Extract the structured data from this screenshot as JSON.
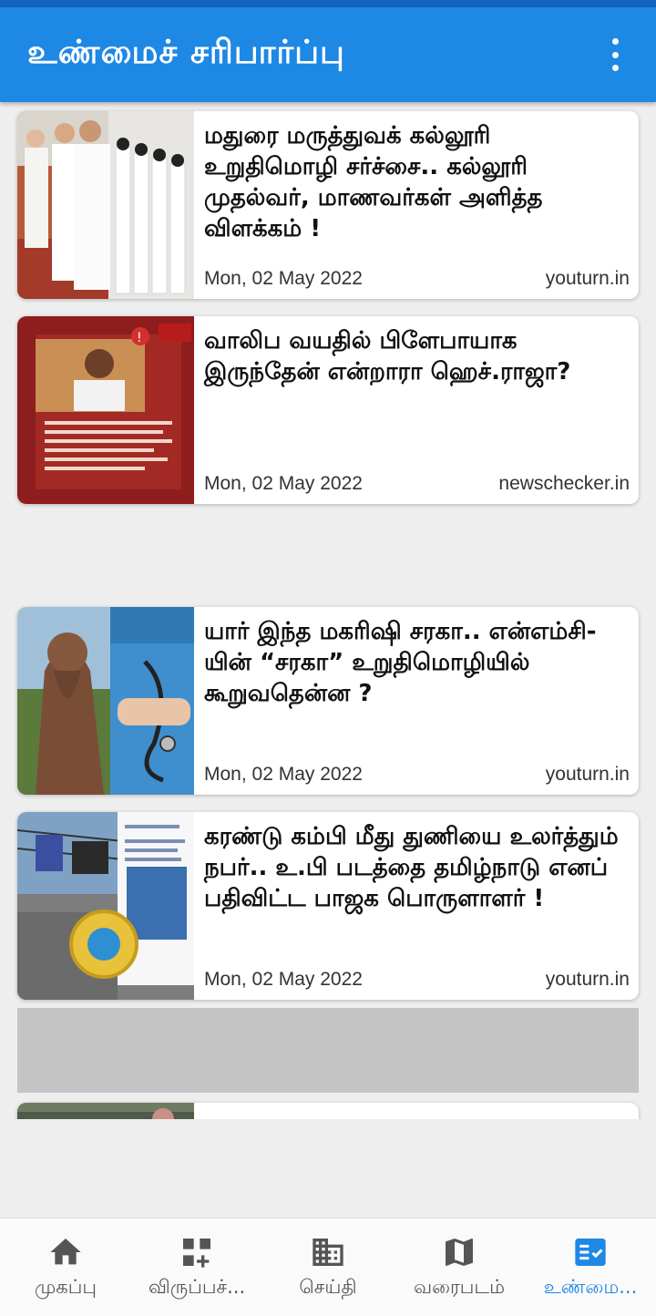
{
  "app": {
    "title": "உண்மைச் சரிபார்ப்பு",
    "colors": {
      "primary": "#1e88e5",
      "background": "#eeeeee",
      "active": "#1e88e5"
    }
  },
  "articles": [
    {
      "headline": "மதுரை மருத்துவக் கல்லூரி உறுதிமொழி சர்ச்சை.. கல்லூரி முதல்வர், மாணவர்கள் அளித்த விளக்கம் !",
      "date": "Mon, 02 May 2022",
      "source": "youturn.in"
    },
    {
      "headline": "வாலிப வயதில் பிளேபாயாக இருந்தேன் என்றாரா ஹெச்.ராஜா?",
      "date": "Mon, 02 May 2022",
      "source": "newschecker.in"
    },
    {
      "headline": "யார் இந்த மகரிஷி சரகா.. என்எம்சி-யின் “சரகா” உறுதிமொழியில் கூறுவதென்ன ?",
      "date": "Mon, 02 May 2022",
      "source": "youturn.in"
    },
    {
      "headline": "கரண்டு கம்பி மீது துணியை உலர்த்தும் நபர்.. உ.பி படத்தை தமிழ்நாடு எனப் பதிவிட்ட பாஜக பொருளாளர் !",
      "date": "Mon, 02 May 2022",
      "source": "youturn.in"
    }
  ],
  "bottom_nav": [
    {
      "label": "முகப்பு",
      "icon": "home-icon"
    },
    {
      "label": "விருப்பச்...",
      "icon": "add-grid-icon"
    },
    {
      "label": "செய்தி",
      "icon": "building-icon"
    },
    {
      "label": "வரைபடம்",
      "icon": "map-icon"
    },
    {
      "label": "உண்மை...",
      "icon": "fact-check-icon",
      "active": true
    }
  ]
}
